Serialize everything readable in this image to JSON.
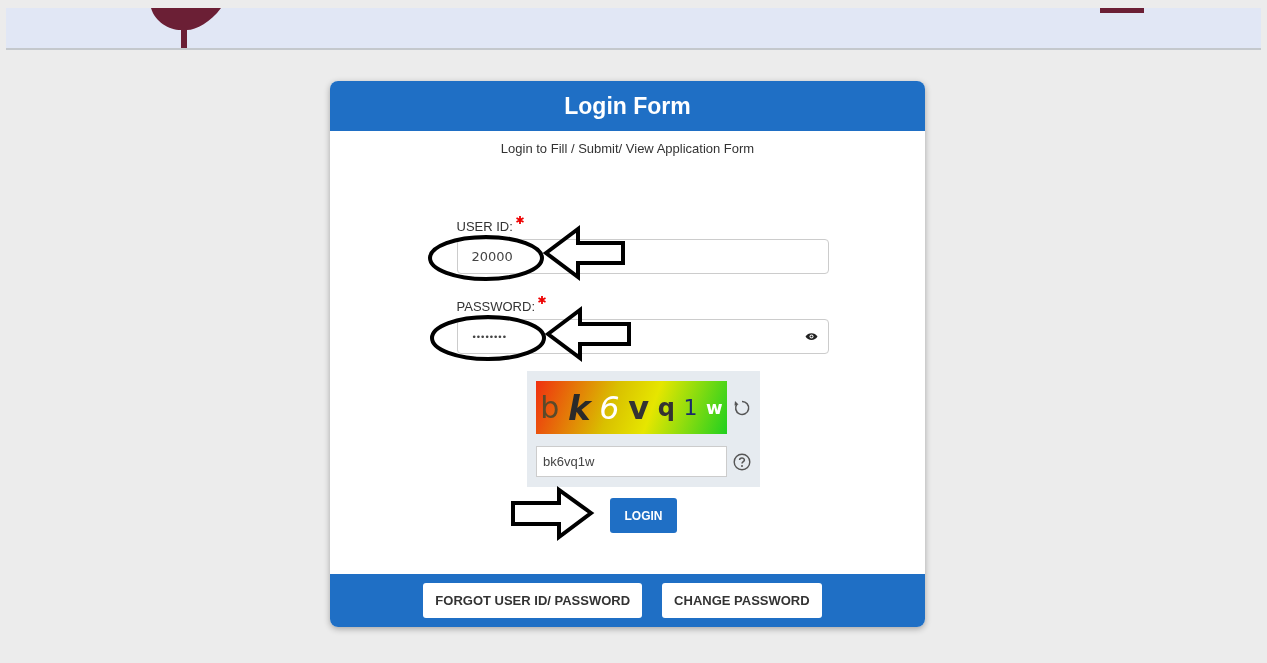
{
  "form": {
    "title": "Login Form",
    "subtitle": "Login to Fill / Submit/ View Application Form"
  },
  "fields": [
    {
      "kind": "text",
      "label": "USER ID:",
      "required": true,
      "value": "20000"
    },
    {
      "kind": "password",
      "label": "PASSWORD:",
      "required": true,
      "value": "••••••••"
    }
  ],
  "captcha": {
    "characters": [
      "b",
      "k",
      "6",
      "v",
      "q",
      "1",
      "w"
    ],
    "value": "bk6vq1w"
  },
  "login_button": "LOGIN",
  "footer_buttons": [
    "FORGOT USER ID/ PASSWORD",
    "CHANGE PASSWORD"
  ]
}
